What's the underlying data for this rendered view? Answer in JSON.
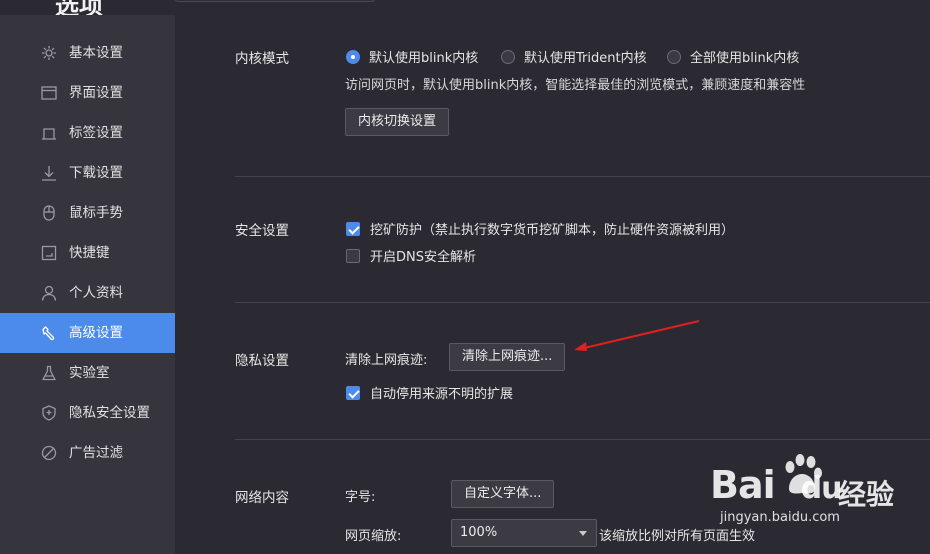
{
  "top": {
    "title": "选项"
  },
  "sidebar": {
    "items": [
      {
        "label": "基本设置",
        "icon": "gear-icon",
        "active": false
      },
      {
        "label": "界面设置",
        "icon": "window-icon",
        "active": false
      },
      {
        "label": "标签设置",
        "icon": "tab-icon",
        "active": false
      },
      {
        "label": "下载设置",
        "icon": "download-icon",
        "active": false
      },
      {
        "label": "鼠标手势",
        "icon": "mouse-icon",
        "active": false
      },
      {
        "label": "快捷键",
        "icon": "shortcut-icon",
        "active": false
      },
      {
        "label": "个人资料",
        "icon": "person-icon",
        "active": false
      },
      {
        "label": "高级设置",
        "icon": "wrench-icon",
        "active": true
      },
      {
        "label": "实验室",
        "icon": "flask-icon",
        "active": false
      },
      {
        "label": "隐私安全设置",
        "icon": "shield-icon",
        "active": false
      },
      {
        "label": "广告过滤",
        "icon": "block-icon",
        "active": false
      }
    ]
  },
  "kernel": {
    "title": "内核模式",
    "options": [
      {
        "label": "默认使用blink内核",
        "checked": true
      },
      {
        "label": "默认使用Trident内核",
        "checked": false
      },
      {
        "label": "全部使用blink内核",
        "checked": false
      }
    ],
    "description": "访问网页时，默认使用blink内核，智能选择最佳的浏览模式，兼顾速度和兼容性",
    "switch_button": "内核切换设置"
  },
  "security": {
    "title": "安全设置",
    "mining_protection": {
      "label": "挖矿防护（禁止执行数字货币挖矿脚本，防止硬件资源被利用）",
      "checked": true
    },
    "dns_security": {
      "label": "开启DNS安全解析",
      "checked": false
    }
  },
  "privacy": {
    "title": "隐私设置",
    "clear_label": "清除上网痕迹:",
    "clear_button": "清除上网痕迹...",
    "auto_disable_ext": {
      "label": "自动停用来源不明的扩展",
      "checked": true
    }
  },
  "network": {
    "title": "网络内容",
    "font_size_label": "字号:",
    "custom_font_button": "自定义字体...",
    "zoom_label": "网页缩放:",
    "zoom_value": "100%",
    "zoom_note": "该缩放比例对所有页面生效"
  },
  "watermark": {
    "brand": "Bai",
    "brand_tail": "du",
    "brand_cn": "经验",
    "url": "jingyan.baidu.com"
  },
  "colors": {
    "accent": "#4c8bea",
    "background": "#2b2a32",
    "sidebar": "#36353d",
    "arrow": "#e02020"
  }
}
